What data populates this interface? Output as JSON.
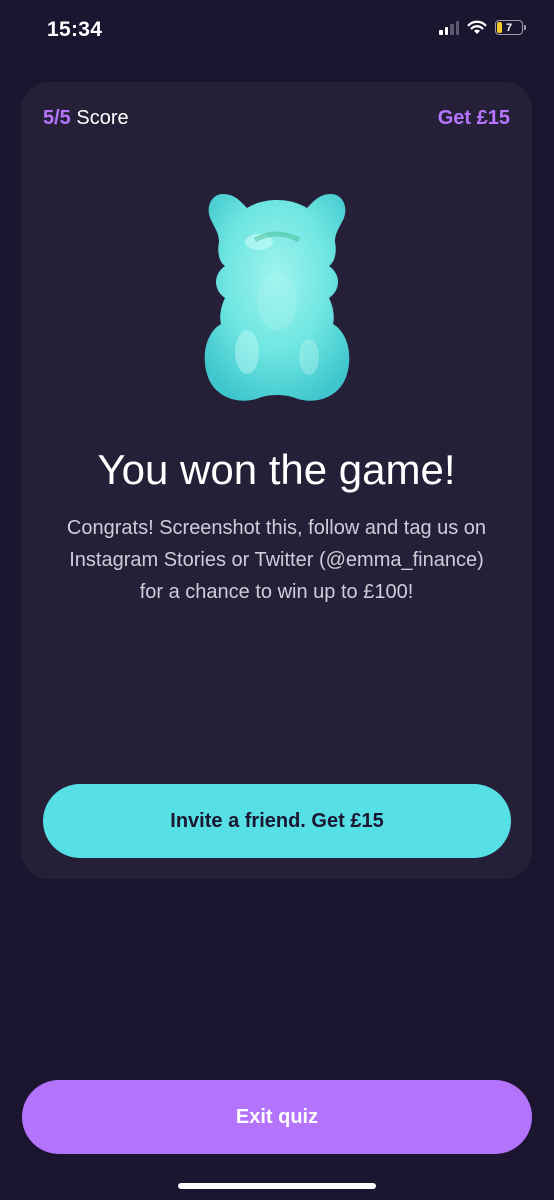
{
  "status_bar": {
    "time": "15:34",
    "battery_level": "7",
    "icons": [
      "signal-icon",
      "wifi-icon",
      "battery-icon"
    ]
  },
  "card": {
    "score_value": "5/5",
    "score_label": "Score",
    "reward_link": "Get £15",
    "image": "gummy-bear-icon",
    "headline": "You won the game!",
    "body": "Congrats! Screenshot this, follow and tag us on Instagram Stories or Twitter (@emma_finance) for a chance to win up to £100!",
    "invite_button": "Invite a friend. Get £15"
  },
  "footer": {
    "exit_button": "Exit quiz"
  },
  "colors": {
    "background": "#1b1530",
    "card": "#252038",
    "accent_purple": "#b575ff",
    "accent_cyan": "#56dfe5"
  }
}
